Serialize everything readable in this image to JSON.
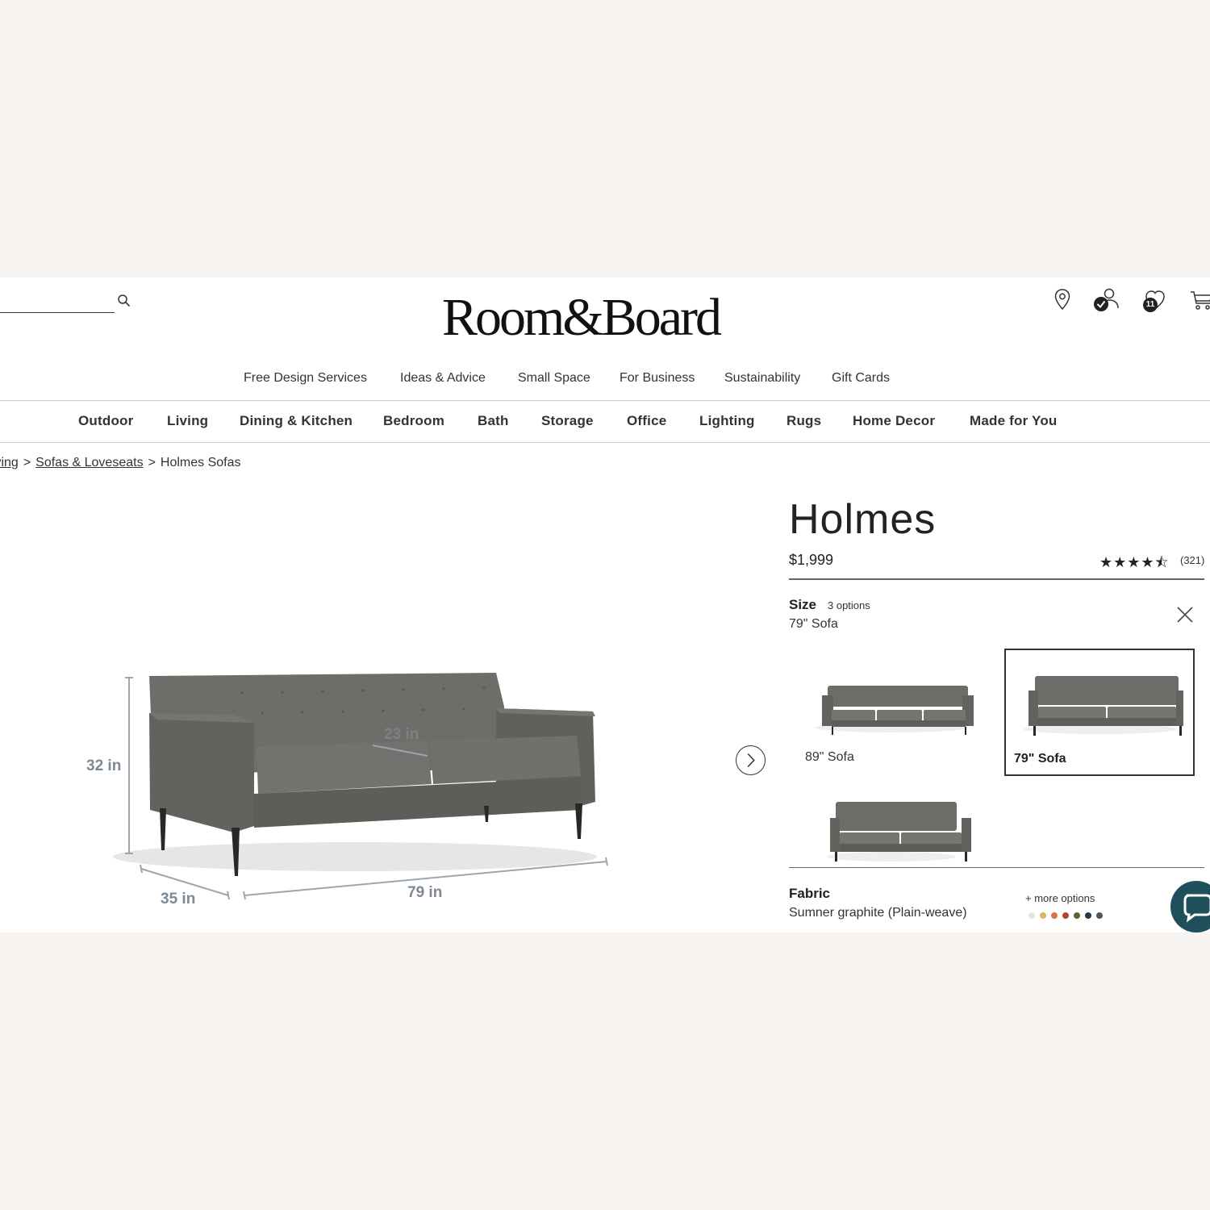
{
  "header": {
    "search_placeholder": "",
    "logo": "Room&Board",
    "wishlist_count": "11"
  },
  "util_nav": [
    {
      "label": "Free Design Services"
    },
    {
      "label": "Ideas & Advice"
    },
    {
      "label": "Small Space"
    },
    {
      "label": "For Business"
    },
    {
      "label": "Sustainability"
    },
    {
      "label": "Gift Cards"
    }
  ],
  "cat_nav": [
    {
      "label": "Outdoor"
    },
    {
      "label": "Living"
    },
    {
      "label": "Dining & Kitchen"
    },
    {
      "label": "Bedroom"
    },
    {
      "label": "Bath"
    },
    {
      "label": "Storage"
    },
    {
      "label": "Office"
    },
    {
      "label": "Lighting"
    },
    {
      "label": "Rugs"
    },
    {
      "label": "Home Decor"
    },
    {
      "label": "Made for You"
    }
  ],
  "breadcrumb": {
    "living": "Living",
    "sofas": "Sofas & Loveseats",
    "current": "Holmes Sofas",
    "sep": ">"
  },
  "hero": {
    "dim_height": "32 in",
    "dim_depth": "35 in",
    "dim_width": "79 in",
    "dim_seat": "23 in"
  },
  "product": {
    "name": "Holmes",
    "price": "$1,999",
    "rating": 4.5,
    "rating_count": "(321)"
  },
  "size": {
    "label": "Size",
    "options_count": "3 options",
    "selected": "79\" Sofa",
    "options": [
      {
        "label": "89\" Sofa"
      },
      {
        "label": "79\" Sofa"
      },
      {
        "label": ""
      }
    ]
  },
  "fabric": {
    "label": "Fabric",
    "selected": "Sumner graphite (Plain-weave)",
    "more_options": "+ more options",
    "swatch_colors": [
      "#e6e4dc",
      "#d9b85a",
      "#d9743f",
      "#b54232",
      "#5f6233",
      "#223a4a",
      "#555555"
    ]
  },
  "colors": {
    "upholstery": "#6b6965",
    "chat": "#1f4f5a"
  }
}
